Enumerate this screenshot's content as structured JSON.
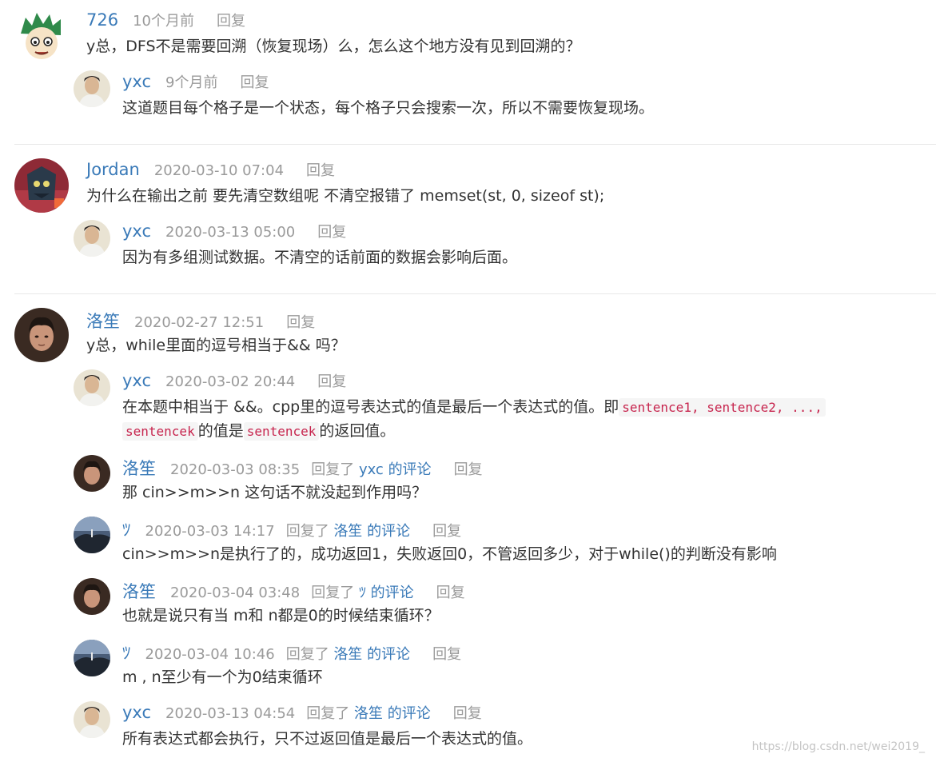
{
  "reply_label": "回复",
  "replied_prefix": "回复了",
  "replied_suffix": "的评论",
  "threads": [
    {
      "author": "726",
      "time": "10个月前",
      "text": "y总，DFS不是需要回溯（恢复现场）么，怎么这个地方没有见到回溯的？",
      "replies": [
        {
          "author": "yxc",
          "time": "9个月前",
          "text": "这道题目每个格子是一个状态，每个格子只会搜索一次，所以不需要恢复现场。"
        }
      ]
    },
    {
      "author": "Jordan",
      "time": "2020-03-10 07:04",
      "text": "为什么在输出之前 要先清空数组呢 不清空报错了 memset(st, 0, sizeof st);",
      "replies": [
        {
          "author": "yxc",
          "time": "2020-03-13 05:00",
          "text": "因为有多组测试数据。不清空的话前面的数据会影响后面。"
        }
      ]
    },
    {
      "author": "洛笙",
      "time": "2020-02-27 12:51",
      "text": "y总，while里面的逗号相当于&& 吗？",
      "replies": [
        {
          "author": "yxc",
          "time": "2020-03-02 20:44",
          "text_1": "在本题中相当于 &&。cpp里的逗号表达式的值是最后一个表达式的值。即",
          "code_1": "sentence1, sentence2, ...,",
          "code_2": "sentencek",
          "text_2": "的值是",
          "code_3": "sentencek",
          "text_3": "的返回值。"
        },
        {
          "author": "洛笙",
          "time": "2020-03-03 08:35",
          "reply_to": "yxc",
          "text": "那 cin>>m>>n 这句话不就没起到作用吗？"
        },
        {
          "author": "ﾂ",
          "time": "2020-03-03 14:17",
          "reply_to": "洛笙",
          "text": "cin>>m>>n是执行了的，成功返回1，失败返回0，不管返回多少，对于while()的判断没有影响"
        },
        {
          "author": "洛笙",
          "time": "2020-03-04 03:48",
          "reply_to": "ﾂ",
          "text": "也就是说只有当 m和 n都是0的时候结束循环？"
        },
        {
          "author": "ﾂ",
          "time": "2020-03-04 10:46",
          "reply_to": "洛笙",
          "text": "m , n至少有一个为0结束循环"
        },
        {
          "author": "yxc",
          "time": "2020-03-13 04:54",
          "reply_to": "洛笙",
          "text": "所有表达式都会执行，只不过返回值是最后一个表达式的值。"
        }
      ]
    }
  ],
  "watermark": "https://blog.csdn.net/wei2019_"
}
